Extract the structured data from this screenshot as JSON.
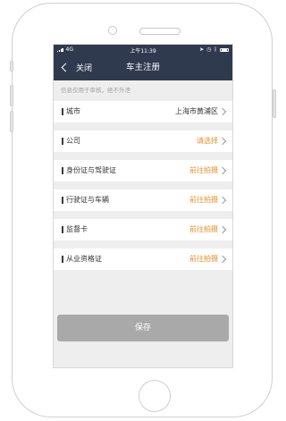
{
  "status_bar": {
    "carrier": "4G",
    "time": "上午11:39"
  },
  "nav": {
    "back_label": "关闭",
    "title": "车主注册"
  },
  "notice": "信息仅用于审核，绝不外泄",
  "rows": [
    {
      "label": "城市",
      "value": "上海市黄浦区",
      "value_style": "default"
    },
    {
      "label": "公司",
      "value": "请选择",
      "value_style": "accent"
    },
    {
      "label": "身份证与驾驶证",
      "value": "前往拍摄",
      "value_style": "accent"
    },
    {
      "label": "行驶证与车辆",
      "value": "前往拍摄",
      "value_style": "accent"
    },
    {
      "label": "监督卡",
      "value": "前往拍摄",
      "value_style": "accent"
    },
    {
      "label": "从业资格证",
      "value": "前往拍摄",
      "value_style": "accent"
    }
  ],
  "save_button": "保存",
  "colors": {
    "nav_background": "#2f3a4f",
    "accent": "#e8902c",
    "save_button": "#a9a9a9",
    "background": "#eeeeee"
  }
}
